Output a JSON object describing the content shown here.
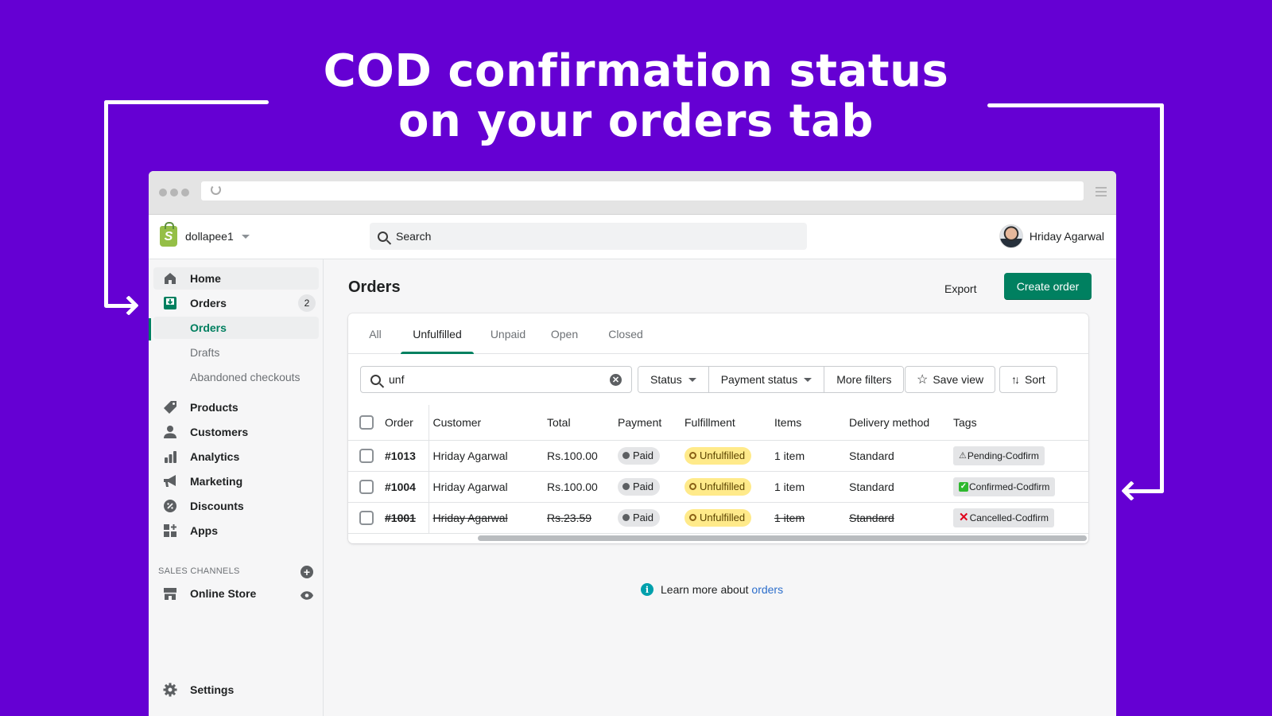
{
  "headline": {
    "line1": "COD confirmation status",
    "line2": "on your orders tab"
  },
  "colors": {
    "background": "#6500d3",
    "primary": "#008060",
    "link": "#2c6ecb",
    "unfulfilled_badge": "#ffea8a"
  },
  "topbar": {
    "store_name": "dollapee1",
    "search_placeholder": "Search",
    "user_name": "Hriday Agarwal"
  },
  "sidebar": {
    "items": [
      {
        "label": "Home",
        "icon": "home-icon"
      },
      {
        "label": "Orders",
        "icon": "orders-icon",
        "badge": "2"
      },
      {
        "label": "Orders",
        "icon": null,
        "sub": true,
        "active": true
      },
      {
        "label": "Drafts",
        "icon": null,
        "sub": true
      },
      {
        "label": "Abandoned checkouts",
        "icon": null,
        "sub": true
      },
      {
        "label": "Products",
        "icon": "tag-icon"
      },
      {
        "label": "Customers",
        "icon": "person-icon"
      },
      {
        "label": "Analytics",
        "icon": "bar-chart-icon"
      },
      {
        "label": "Marketing",
        "icon": "megaphone-icon"
      },
      {
        "label": "Discounts",
        "icon": "discount-icon"
      },
      {
        "label": "Apps",
        "icon": "apps-icon"
      }
    ],
    "sales_channels_label": "SALES CHANNELS",
    "online_store": "Online Store",
    "settings": "Settings"
  },
  "main": {
    "title": "Orders",
    "export_label": "Export",
    "create_label": "Create order",
    "tabs": [
      "All",
      "Unfulfilled",
      "Unpaid",
      "Open",
      "Closed"
    ],
    "active_tab": "Unfulfilled",
    "filter_value": "unf",
    "filter_buttons": [
      "Status",
      "Payment status",
      "More filters"
    ],
    "save_view": "Save view",
    "sort": "Sort",
    "columns": [
      "Order",
      "Customer",
      "Total",
      "Payment",
      "Fulfillment",
      "Items",
      "Delivery method",
      "Tags"
    ],
    "rows": [
      {
        "order": "#1013",
        "customer": "Hriday Agarwal",
        "total": "Rs.100.00",
        "payment": "Paid",
        "fulfillment": "Unfulfilled",
        "items": "1 item",
        "delivery": "Standard",
        "tag": "Pending-Codfirm",
        "tag_icon": "⚠",
        "cancelled": false
      },
      {
        "order": "#1004",
        "customer": "Hriday Agarwal",
        "total": "Rs.100.00",
        "payment": "Paid",
        "fulfillment": "Unfulfilled",
        "items": "1 item",
        "delivery": "Standard",
        "tag": "Confirmed-Codfirm",
        "tag_icon": "✓",
        "cancelled": false
      },
      {
        "order": "#1001",
        "customer": "Hriday Agarwal",
        "total": "Rs.23.59",
        "payment": "Paid",
        "fulfillment": "Unfulfilled",
        "items": "1 item",
        "delivery": "Standard",
        "tag": "Cancelled-Codfirm",
        "tag_icon": "✕",
        "cancelled": true
      }
    ],
    "learn_more_text": "Learn more about ",
    "learn_more_link": "orders"
  }
}
